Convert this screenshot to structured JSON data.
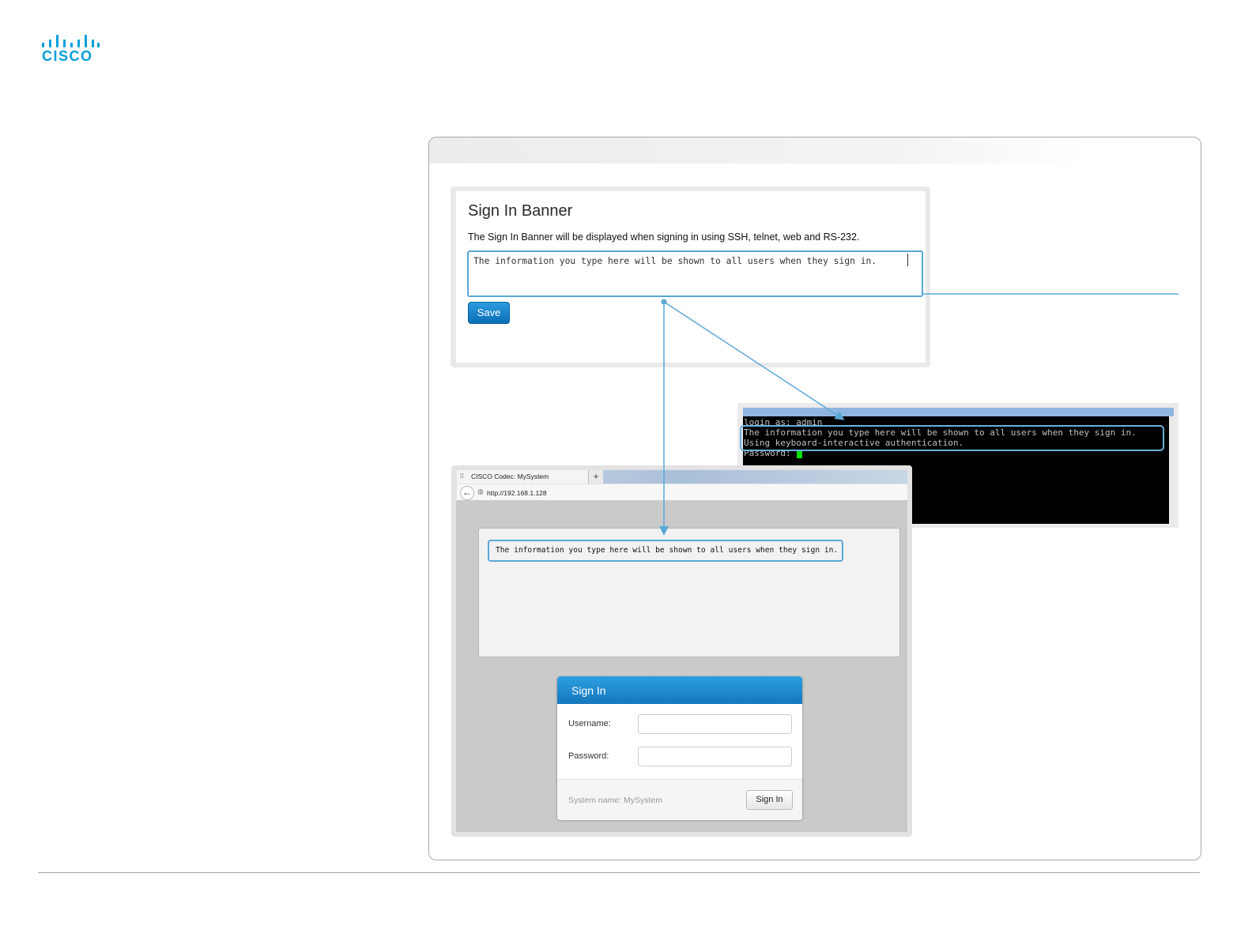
{
  "logo": {
    "wordmark": "CISCO",
    "bar_heights": [
      6,
      10,
      16,
      10,
      6,
      10,
      16,
      10,
      6
    ]
  },
  "settings": {
    "title": "Sign In Banner",
    "description": "The Sign In Banner will be displayed when signing in using SSH, telnet, web and RS-232.",
    "banner_value": "The information you type here will be shown to all users when they sign in.",
    "save_label": "Save"
  },
  "terminal": {
    "lines": [
      "login as: admin",
      "The information you type here will be shown to all users when they sign in.",
      "Using keyboard-interactive authentication.",
      "Password: "
    ],
    "cursor_color": "#00e000"
  },
  "browser": {
    "tab_title": "CISCO Codec: MySystem",
    "new_tab_label": "+",
    "url": "http://192.168.1.128",
    "banner_text": "The information you type here will be shown to all users when they sign in.",
    "signin": {
      "title": "Sign In",
      "username_label": "Username:",
      "password_label": "Password:",
      "system_name": "System name: MySystem",
      "button_label": "Sign In"
    }
  },
  "colors": {
    "accent": "#049fd9",
    "highlight": "#5aa8d8",
    "button_blue": "#0b6fb6"
  }
}
